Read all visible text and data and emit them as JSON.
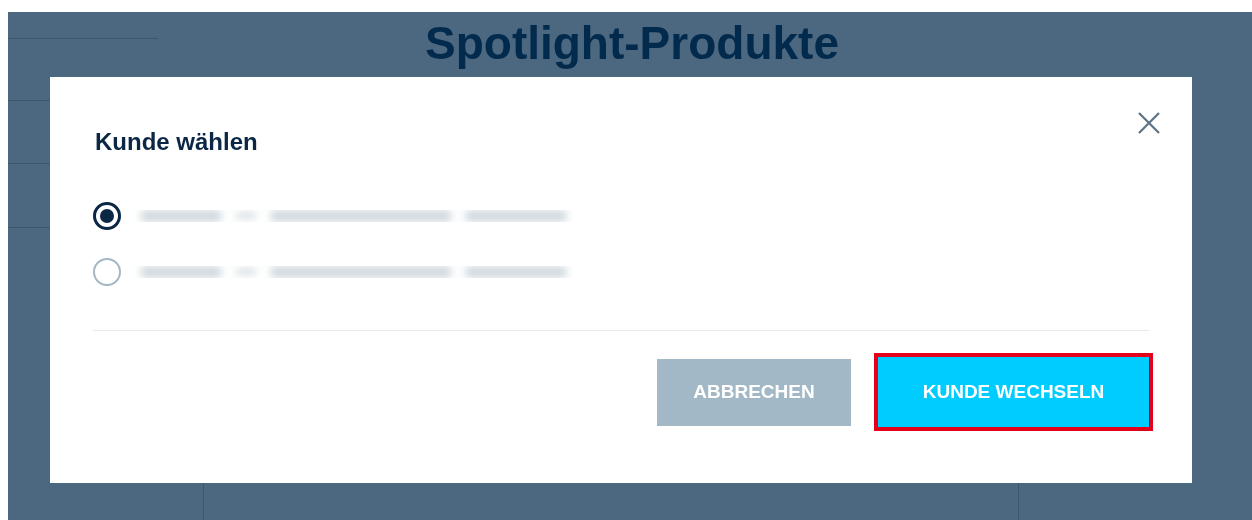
{
  "page": {
    "title": "Spotlight-Produkte"
  },
  "dialog": {
    "title": "Kunde wählen",
    "options": [
      {
        "selected": true
      },
      {
        "selected": false
      }
    ],
    "buttons": [
      {
        "kind": "secondary",
        "label": "ABBRECHEN",
        "highlighted": false
      },
      {
        "kind": "primary",
        "label": "KUNDE WECHSELN",
        "highlighted": true
      }
    ]
  }
}
